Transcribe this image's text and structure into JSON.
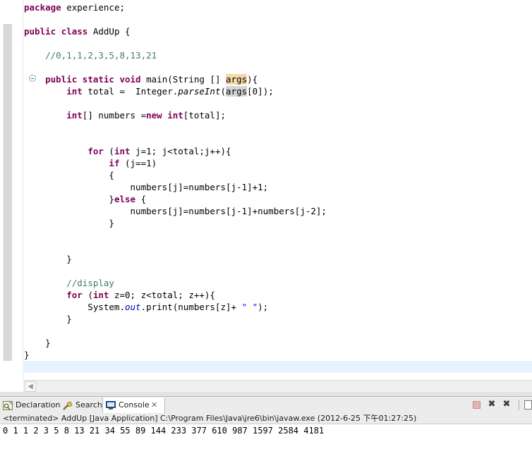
{
  "editor": {
    "lines": [
      {
        "id": "line-1",
        "html": "<span class=\"kw\">package</span> experience;"
      },
      {
        "id": "line-2",
        "html": ""
      },
      {
        "id": "line-3",
        "html": "<span class=\"kw\">public</span> <span class=\"kw\">class</span> AddUp {"
      },
      {
        "id": "line-4",
        "html": ""
      },
      {
        "id": "line-5",
        "html": "    <span class=\"cm\">//0,1,1,2,3,5,8,13,21</span>"
      },
      {
        "id": "line-6",
        "html": ""
      },
      {
        "id": "line-7",
        "html": "    <span class=\"kw\">public</span> <span class=\"kw\">static</span> <span class=\"kw\">void</span> main(String [] <span class=\"occ\">args</span>){"
      },
      {
        "id": "line-8",
        "html": "        <span class=\"kw\">int</span> total =  Integer.<span class=\"it\">parseInt</span>(<span class=\"occ2\">args</span>[0]);"
      },
      {
        "id": "line-9",
        "html": ""
      },
      {
        "id": "line-10",
        "html": "        <span class=\"kw\">int</span>[] numbers =<span class=\"kw\">new</span> <span class=\"kw\">int</span>[total];"
      },
      {
        "id": "line-11",
        "html": ""
      },
      {
        "id": "line-12",
        "html": ""
      },
      {
        "id": "line-13",
        "html": "            <span class=\"kw\">for</span> (<span class=\"kw\">int</span> j=1; j&lt;total;j++){"
      },
      {
        "id": "line-14",
        "html": "                <span class=\"kw\">if</span> (j==1)"
      },
      {
        "id": "line-15",
        "html": "                {"
      },
      {
        "id": "line-16",
        "html": "                    numbers[j]=numbers[j-1]+1;"
      },
      {
        "id": "line-17",
        "html": "                }<span class=\"kw\">else</span> {"
      },
      {
        "id": "line-18",
        "html": "                    numbers[j]=numbers[j-1]+numbers[j-2];"
      },
      {
        "id": "line-19",
        "html": "                }"
      },
      {
        "id": "line-20",
        "html": ""
      },
      {
        "id": "line-21",
        "html": ""
      },
      {
        "id": "line-22",
        "html": "        }"
      },
      {
        "id": "line-23",
        "html": ""
      },
      {
        "id": "line-24",
        "html": "        <span class=\"cm\">//display</span>"
      },
      {
        "id": "line-25",
        "html": "        <span class=\"kw\">for</span> (<span class=\"kw\">int</span> z=0; z&lt;total; z++){"
      },
      {
        "id": "line-26",
        "html": "            System.<span class=\"fld\">out</span>.print(numbers[z]+ <span class=\"str\">\" \"</span>);"
      },
      {
        "id": "line-27",
        "html": "        }"
      },
      {
        "id": "line-28",
        "html": ""
      },
      {
        "id": "line-29",
        "html": "    }"
      },
      {
        "id": "line-30",
        "html": "}"
      },
      {
        "id": "line-31",
        "html": "",
        "current": true
      }
    ]
  },
  "tabs": {
    "declaration": "Declaration",
    "search": "Search",
    "console": "Console",
    "console_close": "✕"
  },
  "toolbar": {
    "remove": "✖",
    "remove_all": "✖"
  },
  "console": {
    "header": "<terminated> AddUp [Java Application] C:\\Program Files\\Java\\jre6\\bin\\javaw.exe (2012-6-25 下午01:27:25)",
    "output": "0 1 1 2 3 5 8 13 21 34 55 89 144 233 377 610 987 1597 2584 4181"
  },
  "colors": {
    "keyword": "#7f0055",
    "comment": "#3f7f5f",
    "string": "#2a00ff",
    "field": "#0000c0",
    "current_line": "#e8f2fe",
    "occurrence": "#f6d7a8"
  },
  "icons": {
    "fold": "collapse-minus-icon",
    "declaration": "declaration-icon",
    "search": "flashlight-search-icon",
    "console": "console-monitor-icon",
    "terminate": "terminate-icon",
    "remove_launch": "remove-launch-icon",
    "remove_all": "remove-all-terminated-icon",
    "clear": "clear-console-icon"
  }
}
